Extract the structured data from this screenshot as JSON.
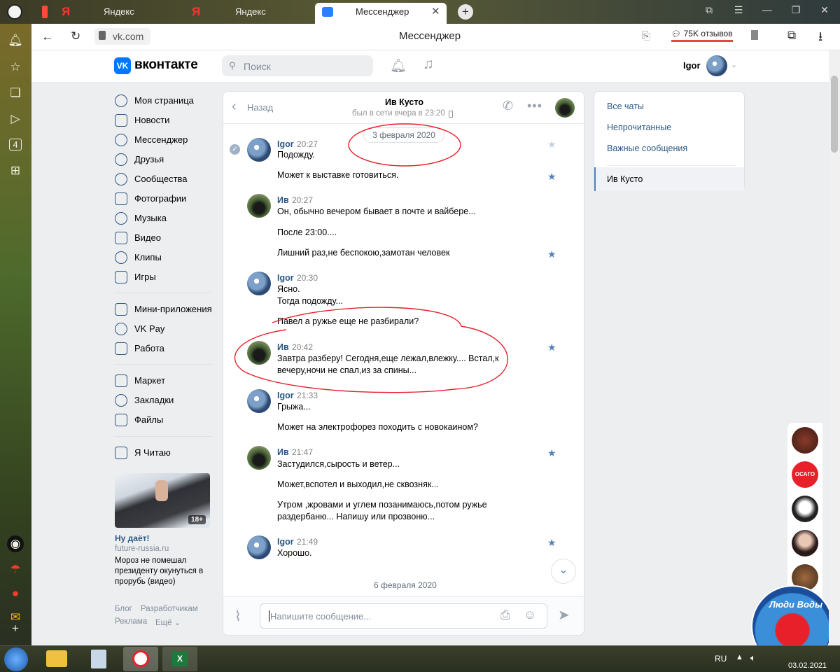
{
  "browser": {
    "tabs": [
      {
        "label": "Яндекс"
      },
      {
        "label": "Яндекс"
      },
      {
        "label": "Мессенджер"
      }
    ],
    "new_tab": "+",
    "address": "vk.com",
    "page_title": "Мессенджер",
    "reviews": "75K отзывов"
  },
  "vk": {
    "logo": "вконтакте",
    "logo_mark": "VK",
    "search_placeholder": "Поиск",
    "user_name": "Igor"
  },
  "menu": {
    "items": [
      {
        "label": "Моя страница"
      },
      {
        "label": "Новости"
      },
      {
        "label": "Мессенджер"
      },
      {
        "label": "Друзья"
      },
      {
        "label": "Сообщества"
      },
      {
        "label": "Фотографии"
      },
      {
        "label": "Музыка"
      },
      {
        "label": "Видео"
      },
      {
        "label": "Клипы"
      },
      {
        "label": "Игры"
      },
      {
        "label": "Мини-приложения"
      },
      {
        "label": "VK Pay"
      },
      {
        "label": "Работа"
      },
      {
        "label": "Маркет"
      },
      {
        "label": "Закладки"
      },
      {
        "label": "Файлы"
      },
      {
        "label": "Я Читаю"
      }
    ],
    "ad": {
      "badge": "18+",
      "title": "Ну даёт!",
      "domain": "future-russia.ru",
      "text": "Мороз не помешал президенту окунуться в прорубь (видео)"
    },
    "footer": [
      "Блог",
      "Разработчикам",
      "Реклама",
      "Ещё ⌄"
    ]
  },
  "chat": {
    "back": "Назад",
    "contact": "Ив Кусто",
    "status": "был в сети вчера в 23:20",
    "date1": "3 февраля 2020",
    "date2": "6 февраля 2020",
    "input_placeholder": "Напишите сообщение...",
    "messages": [
      {
        "author": "Igor",
        "time": "20:27",
        "lines": [
          "Подожду.",
          "Может к выставке готовиться."
        ]
      },
      {
        "author": "Ив",
        "time": "20:27",
        "lines": [
          "Он, обычно вечером бывает в почте и вайбере...",
          "После 23:00....",
          "Лишний раз,не беспокою,замотан человек"
        ]
      },
      {
        "author": "Igor",
        "time": "20:30",
        "lines": [
          "Ясно.",
          "Тогда подожду...",
          "Павел а ружье еще не разбирали?"
        ]
      },
      {
        "author": "Ив",
        "time": "20:42",
        "lines": [
          "Завтра разберу! Сегодня,еще лежал,влежку.... Встал,к",
          "вечеру,ночи не спал,из за спины..."
        ]
      },
      {
        "author": "Igor",
        "time": "21:33",
        "lines": [
          "Грыжа...",
          "Может на электрофорез походить с новокаином?"
        ]
      },
      {
        "author": "Ив",
        "time": "21:47",
        "lines": [
          "Застудился,сырость и ветер...",
          "Может,вспотел и выходил,не сквозняк...",
          "Утром ,жровами и углем позанимаюсь,потом ружье",
          "раздербаню... Напишу или прозвоню..."
        ]
      },
      {
        "author": "Igor",
        "time": "21:49",
        "lines": [
          "Хорошо."
        ]
      }
    ]
  },
  "right_panel": {
    "items": [
      "Все чаты",
      "Непрочитанные",
      "Важные сообщения"
    ],
    "active": "Ив Кусто"
  },
  "friends_badge": "ОСАГО",
  "watermark": "Люди Воды",
  "taskbar": {
    "lang": "RU",
    "date": "03.02.2021"
  },
  "colors": {
    "vk_blue": "#0077ff",
    "link": "#2a5885",
    "star_active": "#5181b8",
    "star_inactive": "#c5d0db",
    "annotation_red": "#e8202a"
  }
}
